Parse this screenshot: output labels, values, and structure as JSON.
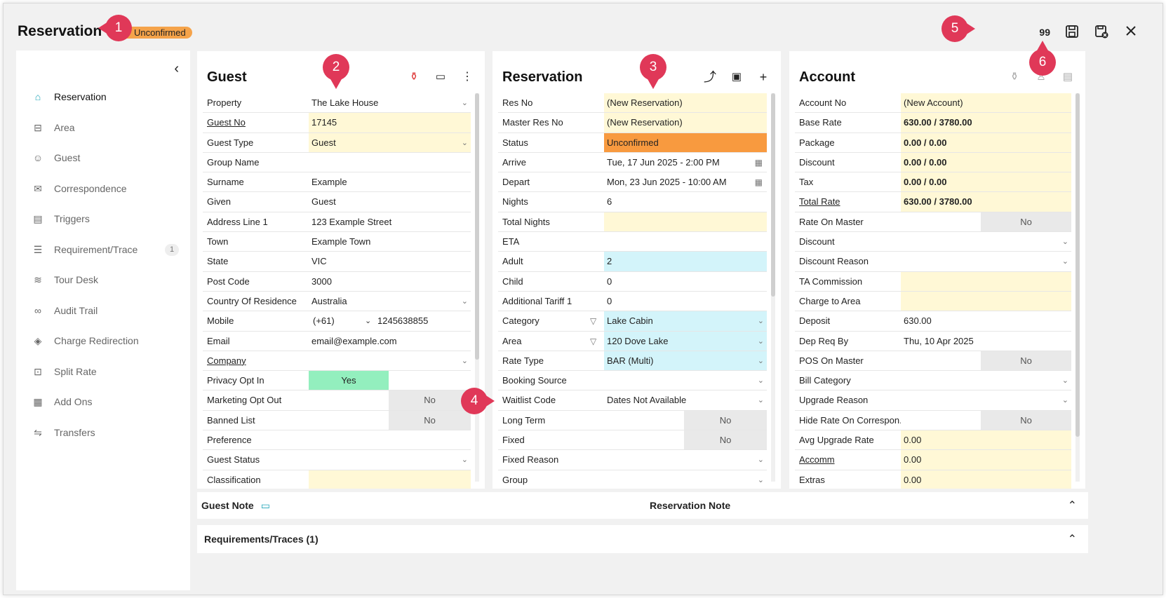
{
  "header": {
    "title": "Reservation",
    "status_badge": "Unconfirmed",
    "count": "99"
  },
  "markers": [
    "1",
    "2",
    "3",
    "4",
    "5",
    "6"
  ],
  "sidebar": {
    "items": [
      {
        "label": "Reservation",
        "icon": "home-icon"
      },
      {
        "label": "Area",
        "icon": "bed-icon"
      },
      {
        "label": "Guest",
        "icon": "users-icon"
      },
      {
        "label": "Correspondence",
        "icon": "mail-icon"
      },
      {
        "label": "Triggers",
        "icon": "trigger-icon"
      },
      {
        "label": "Requirement/Trace",
        "icon": "list-icon",
        "badge": "1"
      },
      {
        "label": "Tour Desk",
        "icon": "tour-icon"
      },
      {
        "label": "Audit Trail",
        "icon": "glasses-icon"
      },
      {
        "label": "Charge Redirection",
        "icon": "redirect-icon"
      },
      {
        "label": "Split Rate",
        "icon": "split-icon"
      },
      {
        "label": "Add Ons",
        "icon": "addons-icon"
      },
      {
        "label": "Transfers",
        "icon": "transfer-icon"
      }
    ]
  },
  "guest": {
    "title": "Guest",
    "rows": [
      {
        "label": "Property",
        "value": "The Lake House"
      },
      {
        "label": "Guest No",
        "value": "17145"
      },
      {
        "label": "Guest Type",
        "value": "Guest"
      },
      {
        "label": "Group Name",
        "value": ""
      },
      {
        "label": "Surname",
        "value": "Example"
      },
      {
        "label": "Given",
        "value": "Guest"
      },
      {
        "label": "Address Line 1",
        "value": "123 Example Street"
      },
      {
        "label": "Town",
        "value": "Example Town"
      },
      {
        "label": "State",
        "value": "VIC"
      },
      {
        "label": "Post Code",
        "value": "3000"
      },
      {
        "label": "Country Of Residence",
        "value": "Australia"
      },
      {
        "label": "Mobile",
        "value": "(+61)",
        "value2": "1245638855"
      },
      {
        "label": "Email",
        "value": "email@example.com"
      },
      {
        "label": "Company",
        "value": ""
      },
      {
        "label": "Privacy Opt In",
        "value": "Yes"
      },
      {
        "label": "Marketing Opt Out",
        "value": "No"
      },
      {
        "label": "Banned List",
        "value": "No"
      },
      {
        "label": "Preference",
        "value": ""
      },
      {
        "label": "Guest Status",
        "value": ""
      },
      {
        "label": "Classification",
        "value": ""
      }
    ]
  },
  "reservation": {
    "title": "Reservation",
    "rows": [
      {
        "label": "Res No",
        "value": "(New Reservation)"
      },
      {
        "label": "Master Res No",
        "value": "(New Reservation)"
      },
      {
        "label": "Status",
        "value": "Unconfirmed"
      },
      {
        "label": "Arrive",
        "value": "Tue, 17 Jun 2025 - 2:00 PM"
      },
      {
        "label": "Depart",
        "value": "Mon, 23 Jun 2025 - 10:00 AM"
      },
      {
        "label": "Nights",
        "value": "6"
      },
      {
        "label": "Total Nights",
        "value": ""
      },
      {
        "label": "ETA",
        "value": ""
      },
      {
        "label": "Adult",
        "value": "2"
      },
      {
        "label": "Child",
        "value": "0"
      },
      {
        "label": "Additional Tariff 1",
        "value": "0"
      },
      {
        "label": "Category",
        "value": "Lake Cabin"
      },
      {
        "label": "Area",
        "value": "120 Dove Lake"
      },
      {
        "label": "Rate Type",
        "value": "BAR (Multi)"
      },
      {
        "label": "Booking Source",
        "value": ""
      },
      {
        "label": "Waitlist Code",
        "value": "Dates Not Available"
      },
      {
        "label": "Long Term",
        "value": "No"
      },
      {
        "label": "Fixed",
        "value": "No"
      },
      {
        "label": "Fixed Reason",
        "value": ""
      },
      {
        "label": "Group",
        "value": ""
      }
    ]
  },
  "account": {
    "title": "Account",
    "rows": [
      {
        "label": "Account No",
        "value": "(New Account)"
      },
      {
        "label": "Base Rate",
        "value": "630.00 / 3780.00"
      },
      {
        "label": "Package",
        "value": "0.00 / 0.00"
      },
      {
        "label": "Discount",
        "value": "0.00 / 0.00"
      },
      {
        "label": "Tax",
        "value": "0.00 / 0.00"
      },
      {
        "label": "Total Rate",
        "value": "630.00 / 3780.00"
      },
      {
        "label": "Rate On Master",
        "value": "No"
      },
      {
        "label": "Discount",
        "value": ""
      },
      {
        "label": "Discount Reason",
        "value": ""
      },
      {
        "label": "TA Commission",
        "value": ""
      },
      {
        "label": "Charge to Area",
        "value": ""
      },
      {
        "label": "Deposit",
        "value": "630.00"
      },
      {
        "label": "Dep Req By",
        "value": "Thu, 10 Apr 2025"
      },
      {
        "label": "POS On Master",
        "value": "No"
      },
      {
        "label": "Bill Category",
        "value": ""
      },
      {
        "label": "Upgrade Reason",
        "value": ""
      },
      {
        "label": "Hide Rate On Correspon...",
        "value": "No"
      },
      {
        "label": "Avg Upgrade Rate",
        "value": "0.00"
      },
      {
        "label": "Accomm",
        "value": "0.00"
      },
      {
        "label": "Extras",
        "value": "0.00"
      }
    ]
  },
  "bottom": {
    "guest_note": "Guest Note",
    "reservation_note": "Reservation Note",
    "requirements": "Requirements/Traces (1)"
  }
}
